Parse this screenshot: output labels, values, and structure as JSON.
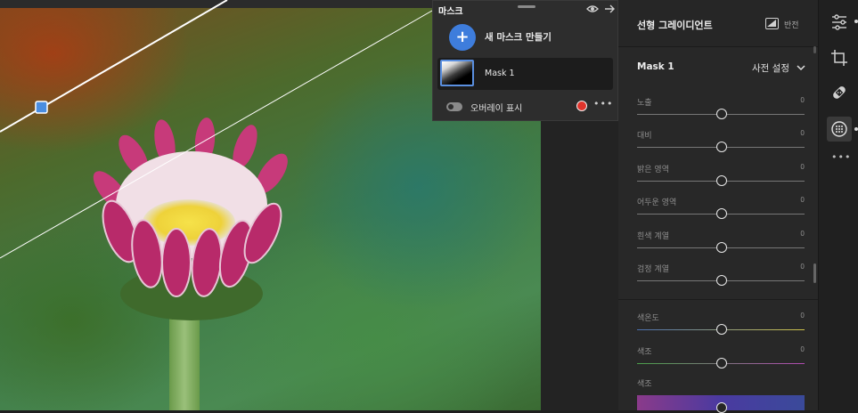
{
  "mask_panel": {
    "title": "마스크",
    "new_mask_label": "새 마스크 만들기",
    "new_mask_icon": "+",
    "masks": [
      {
        "name": "Mask 1"
      }
    ],
    "overlay_label": "오버레이 표시",
    "overlay_color": "#e0342c",
    "more": "•••"
  },
  "edit_panel": {
    "title": "선형 그레이디언트",
    "invert_label": "반전",
    "mask_name": "Mask 1",
    "preset_label": "사전 설정",
    "light_sliders": [
      {
        "label": "노출",
        "value": "0"
      },
      {
        "label": "대비",
        "value": "0"
      },
      {
        "label": "밝은 영역",
        "value": "0"
      },
      {
        "label": "어두운 영역",
        "value": "0"
      },
      {
        "label": "흰색 계열",
        "value": "0"
      },
      {
        "label": "검정 계열",
        "value": "0"
      }
    ],
    "color_sliders": [
      {
        "label": "색온도",
        "value": "0"
      },
      {
        "label": "색조",
        "value": "0"
      }
    ],
    "hue_label": "색조"
  },
  "tool_rail": {
    "tools": [
      "edit-sliders-icon",
      "crop-icon",
      "heal-bandage-icon",
      "masking-icon"
    ],
    "more": "•••"
  }
}
